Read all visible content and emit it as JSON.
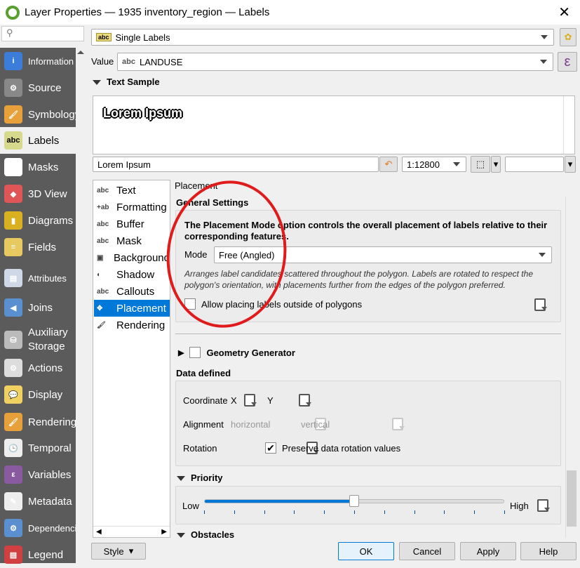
{
  "window": {
    "title": "Layer Properties — 1935 inventory_region — Labels",
    "close": "✕"
  },
  "sidebar": {
    "items": [
      {
        "label": "Information",
        "color": "#3b7dd8",
        "icon": "i"
      },
      {
        "label": "Source",
        "color": "#888",
        "icon": "⚙"
      },
      {
        "label": "Symbology",
        "color": "#e8a13a",
        "icon": "🖌"
      },
      {
        "label": "Labels",
        "color": "#d6d98b",
        "icon": "abc"
      },
      {
        "label": "Masks",
        "color": "#fff",
        "icon": "abc"
      },
      {
        "label": "3D View",
        "color": "#e05555",
        "icon": "◆"
      },
      {
        "label": "Diagrams",
        "color": "#d9b020",
        "icon": "▮"
      },
      {
        "label": "Fields",
        "color": "#e8c860",
        "icon": "≡"
      },
      {
        "label": "Attributes",
        "color": "#cfd8e6",
        "icon": "▤"
      },
      {
        "label": "Joins",
        "color": "#5a8fd0",
        "icon": "◀"
      },
      {
        "label": "Auxiliary Storage",
        "color": "#bbb",
        "icon": "⛁"
      },
      {
        "label": "Actions",
        "color": "#ddd",
        "icon": "⚙"
      },
      {
        "label": "Display",
        "color": "#f0d060",
        "icon": "💬"
      },
      {
        "label": "Rendering",
        "color": "#e8a13a",
        "icon": "🖌"
      },
      {
        "label": "Temporal",
        "color": "#eee",
        "icon": "🕒"
      },
      {
        "label": "Variables",
        "color": "#8a5aa0",
        "icon": "ε"
      },
      {
        "label": "Metadata",
        "color": "#eee",
        "icon": "✎"
      },
      {
        "label": "Dependencies",
        "color": "#5a8fd0",
        "icon": "⚙"
      },
      {
        "label": "Legend",
        "color": "#d04040",
        "icon": "▤"
      }
    ],
    "selected": "Labels"
  },
  "mode_combo": {
    "value": "Single Labels",
    "icon": "abc"
  },
  "value_row": {
    "label": "Value",
    "value": "LANDUSE",
    "prefix": "abc",
    "expr": "ε"
  },
  "text_sample": {
    "header": "Text Sample",
    "preview": "Lorem Ipsum",
    "input": "Lorem Ipsum",
    "scale": "1:12800"
  },
  "tabs": [
    {
      "label": "Text",
      "icon": "abc"
    },
    {
      "label": "Formatting",
      "icon": "+ab"
    },
    {
      "label": "Buffer",
      "icon": "abc"
    },
    {
      "label": "Mask",
      "icon": "abc"
    },
    {
      "label": "Background",
      "icon": "▣"
    },
    {
      "label": "Shadow",
      "icon": "◐"
    },
    {
      "label": "Callouts",
      "icon": "abc"
    },
    {
      "label": "Placement",
      "icon": "✥"
    },
    {
      "label": "Rendering",
      "icon": "🖌"
    }
  ],
  "selected_tab": "Placement",
  "placement": {
    "title": "Placement",
    "general_settings": "General Settings",
    "description": "The Placement Mode option controls the overall placement of labels relative to their corresponding features.",
    "mode_label": "Mode",
    "mode_value": "Free (Angled)",
    "mode_help": "Arranges label candidates scattered throughout the polygon. Labels are rotated to respect the polygon's orientation, with placements further from the edges of the polygon preferred.",
    "allow_outside": {
      "label": "Allow placing labels outside of polygons",
      "checked": false
    },
    "geometry_generator": {
      "label": "Geometry Generator",
      "checked": false
    },
    "data_defined": "Data defined",
    "coordinate": "Coordinate",
    "x": "X",
    "y": "Y",
    "alignment": "Alignment",
    "horizontal": "horizontal",
    "vertical": "vertical",
    "rotation": "Rotation",
    "preserve": {
      "label": "Preserve data rotation values",
      "checked": true
    },
    "priority": "Priority",
    "low": "Low",
    "high": "High",
    "priority_value": 5,
    "priority_max": 10,
    "obstacles": "Obstacles"
  },
  "footer": {
    "style": "Style",
    "ok": "OK",
    "cancel": "Cancel",
    "apply": "Apply",
    "help": "Help"
  },
  "annotation_color": "#e01b1b",
  "accent": "#0078d7"
}
